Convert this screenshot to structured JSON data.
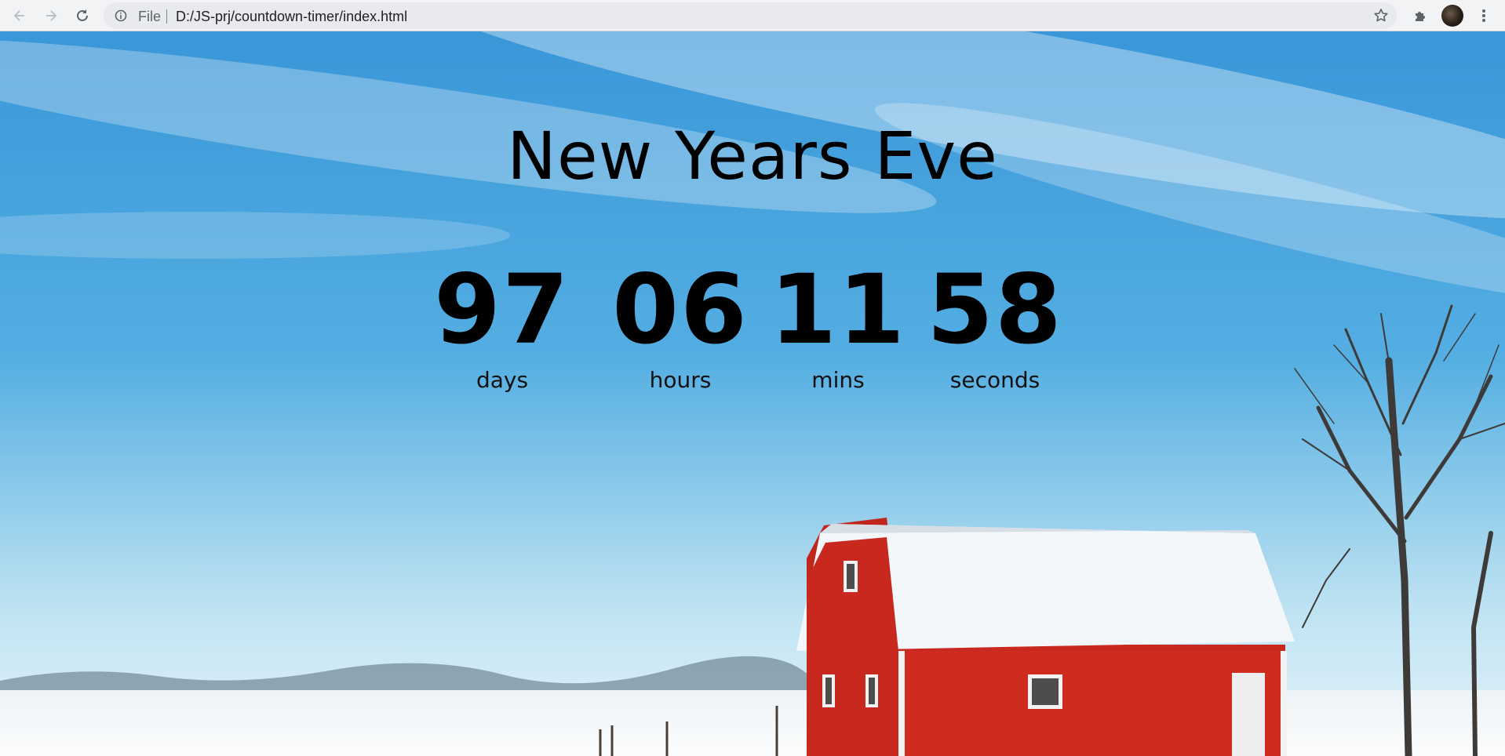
{
  "browser": {
    "scheme": "File",
    "url": "D:/JS-prj/countdown-timer/index.html"
  },
  "page": {
    "title": "New Years Eve",
    "units": [
      {
        "value": "97",
        "label": "days"
      },
      {
        "value": "06",
        "label": "hours"
      },
      {
        "value": "11",
        "label": "mins"
      },
      {
        "value": "58",
        "label": "seconds"
      }
    ]
  },
  "colors": {
    "sky_top": "#3a97d8",
    "sky_bottom": "#bfe3f2",
    "barn_red": "#c8281e",
    "snow": "#f4f7fa"
  }
}
